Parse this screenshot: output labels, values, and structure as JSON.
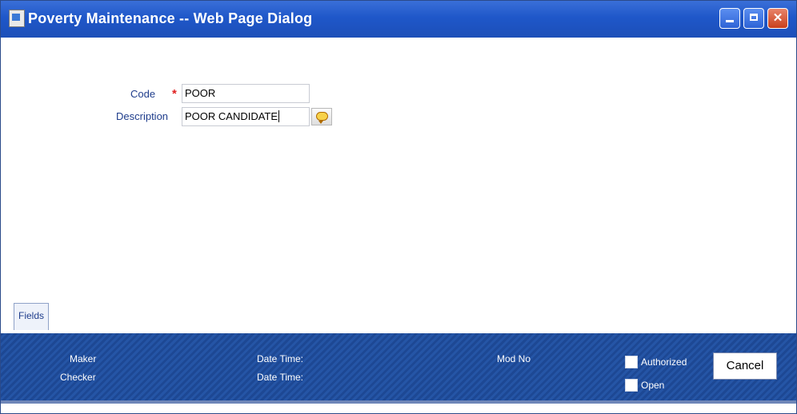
{
  "window": {
    "title": "Poverty Maintenance -- Web Page Dialog"
  },
  "form": {
    "code_label": "Code",
    "code_required_mark": "*",
    "code_value": "POOR",
    "description_label": "Description",
    "description_value": "POOR CANDIDATE"
  },
  "tabs": [
    "Fields"
  ],
  "footer": {
    "maker_label": "Maker",
    "checker_label": "Checker",
    "maker_datetime_label": "Date Time:",
    "checker_datetime_label": "Date Time:",
    "mod_no_label": "Mod No",
    "authorized_label": "Authorized",
    "open_label": "Open",
    "cancel_label": "Cancel"
  }
}
